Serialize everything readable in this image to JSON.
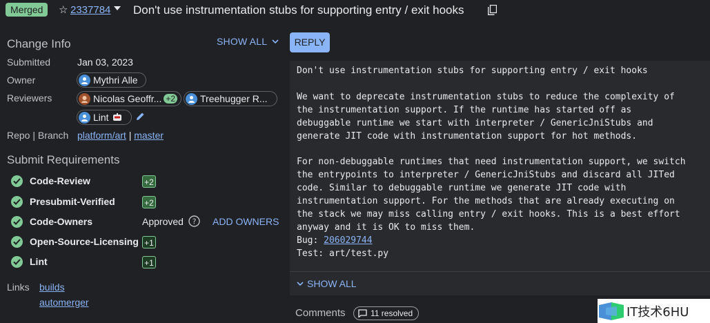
{
  "header": {
    "status": "Merged",
    "change_number": "2337784",
    "title": "Don't use instrumentation stubs for supporting entry / exit hooks"
  },
  "change_info": {
    "heading": "Change Info",
    "show_all": "SHOW ALL",
    "submitted_label": "Submitted",
    "submitted_value": "Jan 03, 2023",
    "owner_label": "Owner",
    "owner": "Mythri Alle",
    "reviewers_label": "Reviewers",
    "reviewers": [
      {
        "name": "Nicolas Geoffr...",
        "vote": "+2"
      },
      {
        "name": "Treehugger R..."
      },
      {
        "name": "Lint"
      }
    ],
    "repo_label": "Repo | Branch",
    "repo": "platform/art",
    "separator": "|",
    "branch": "master"
  },
  "submit_requirements": {
    "heading": "Submit Requirements",
    "items": [
      {
        "name": "Code-Review",
        "status": "+2"
      },
      {
        "name": "Presubmit-Verified",
        "status": "+2"
      },
      {
        "name": "Code-Owners",
        "status": "Approved",
        "action": "ADD OWNERS"
      },
      {
        "name": "Open-Source-Licensing",
        "status": "+1"
      },
      {
        "name": "Lint",
        "status": "+1"
      }
    ]
  },
  "links": {
    "label": "Links",
    "items": [
      "builds",
      "automerger"
    ]
  },
  "message": {
    "reply": "REPLY",
    "body": "Don't use instrumentation stubs for supporting entry / exit hooks\n\nWe want to deprecate instrumentation stubs to reduce the complexity of\nthe instrumentation support. If the runtime has started off as\ndebuggable runtime we start with interpreter / GenericJniStubs and\ngenerate JIT code with instrumentation support for hot methods.\n\nFor non-debuggable runtimes that need instrumentation support, we switch\nthe entrypoints to interpreter / GenericJniStubs and discard all JITed\ncode. Similar to debuggable runtime we generate JIT code with\ninstrumentation support. For the methods that are already executing on\nthe stack we may miss calling entry / exit hooks. This is a best effort\nanyway and it is OK to miss them.\n",
    "bug_label": "Bug: ",
    "bug": "206029744",
    "test_line": "Test: art/test.py",
    "show_all": "SHOW ALL"
  },
  "comments": {
    "label": "Comments",
    "resolved": "11 resolved"
  },
  "watermark": {
    "text": "IT技术6HU"
  },
  "colors": {
    "accent": "#8ab4f8",
    "success": "#81c995",
    "background": "#202124",
    "panel": "#292a2d"
  }
}
